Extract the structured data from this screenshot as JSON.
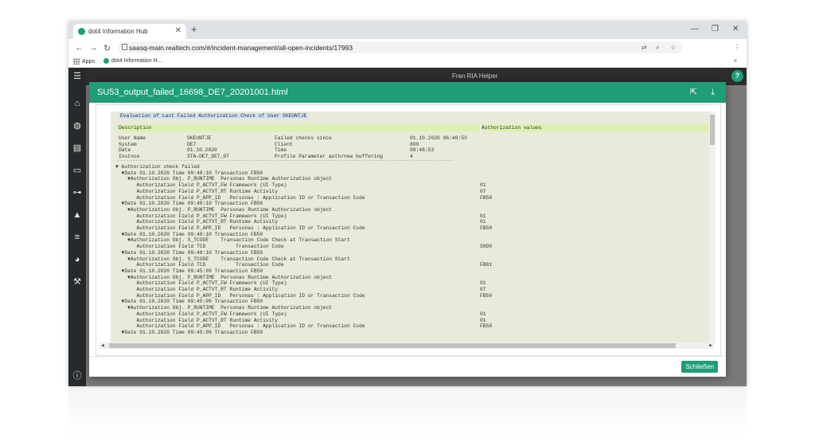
{
  "browser": {
    "tab_title": "dot4 Information Hub",
    "url": "saasq-main.realtech.com/#/incident-management/all-open-incidents/17993",
    "bookmark_apps": "Apps",
    "bookmark_hub": "dot4 Information H..."
  },
  "app": {
    "search_hint": "Fran RIA Helper"
  },
  "modal": {
    "title": "SU53_output_failed_16698_DE7_20201001.html",
    "close_label": "Schließen"
  },
  "report": {
    "heading": "Evaluation of Last Failed Authorization Check of User SKEUNTJE",
    "col_description": "Description",
    "col_auth_values": "Authorization values",
    "info_left": [
      {
        "label": "User Name",
        "value": "SKEUNTJE"
      },
      {
        "label": "System",
        "value": "DE7"
      },
      {
        "label": "Date",
        "value": "01.10.2020"
      },
      {
        "label": "Instnce",
        "value": "STA-DE7_DE7_07"
      }
    ],
    "info_right": [
      {
        "label": "Failed checks since",
        "value": "01.10.2020 06:48:53"
      },
      {
        "label": "Client",
        "value": "800"
      },
      {
        "label": "Time",
        "value": "09:48:53"
      },
      {
        "label": "Profile Parameter auth/new buffering",
        "value": "4"
      }
    ],
    "rule": "----------------------------------------------------------------------------------------------------------------",
    "lines": [
      {
        "text": "▼ Authorization check failed",
        "value": ""
      },
      {
        "text": "  ▼Date 01.10.2020 Time 09:48:10 Transaction FB50",
        "value": ""
      },
      {
        "text": "    ▼Authorization Obj. P_RUNTIME  Personas Runtime Authorization object",
        "value": ""
      },
      {
        "text": "       Authorization Field P_ACTVT_FW Framework (UI Type)",
        "value": "01"
      },
      {
        "text": "       Authorization Field P_ACTVT_RT Runtime Activity",
        "value": "07"
      },
      {
        "text": "       Authorization Field P_APP_ID   Personas : Application ID or Transaction Code",
        "value": "FB50"
      },
      {
        "text": "  ▼Date 01.10.2020 Time 09:48:10 Transaction FB50",
        "value": ""
      },
      {
        "text": "    ▼Authorization Obj. P_RUNTIME  Personas Runtime Authorization object",
        "value": ""
      },
      {
        "text": "       Authorization Field P_ACTVT_FW Framework (UI Type)",
        "value": "01"
      },
      {
        "text": "       Authorization Field P_ACTVT_RT Runtime Activity",
        "value": "01"
      },
      {
        "text": "       Authorization Field P_APP_ID   Personas : Application ID or Transaction Code",
        "value": "FB50"
      },
      {
        "text": "  ▼Date 01.10.2020 Time 09:48:10 Transaction FB50",
        "value": ""
      },
      {
        "text": "    ▼Authorization Obj. S_TCODE    Transaction Code Check at Transaction Start",
        "value": ""
      },
      {
        "text": "       Authorization Field TCD          Transaction Code",
        "value": "SHD0"
      },
      {
        "text": "  ▼Date 01.10.2020 Time 09:48:10 Transaction FB50",
        "value": ""
      },
      {
        "text": "    ▼Authorization Obj. S_TCODE    Transaction Code Check at Transaction Start",
        "value": ""
      },
      {
        "text": "       Authorization Field TCD          Transaction Code",
        "value": "FB01"
      },
      {
        "text": "  ▼Date 01.10.2020 Time 09:45:09 Transaction FB50",
        "value": ""
      },
      {
        "text": "    ▼Authorization Obj. P_RUNTIME  Personas Runtime Authorization object",
        "value": ""
      },
      {
        "text": "       Authorization Field P_ACTVT_FW Framework (UI Type)",
        "value": "01"
      },
      {
        "text": "       Authorization Field P_ACTVT_RT Runtime Activity",
        "value": "07"
      },
      {
        "text": "       Authorization Field P_APP_ID   Personas : Application ID or Transaction Code",
        "value": "FB50"
      },
      {
        "text": "  ▼Date 01.10.2020 Time 09:45:09 Transaction FB50",
        "value": ""
      },
      {
        "text": "    ▼Authorization Obj. P_RUNTIME  Personas Runtime Authorization object",
        "value": ""
      },
      {
        "text": "       Authorization Field P_ACTVT_FW Framework (UI Type)",
        "value": "01"
      },
      {
        "text": "       Authorization Field P_ACTVT_RT Runtime Activity",
        "value": "01"
      },
      {
        "text": "       Authorization Field P_APP_ID   Personas : Application ID or Transaction Code",
        "value": "FB50"
      },
      {
        "text": "  ▼Date 01.10.2020 Time 09:45:09 Transaction FB50",
        "value": ""
      }
    ]
  },
  "colors": {
    "accent": "#1f9c78",
    "report_bg": "#e9ead9",
    "desc_bar": "#dcf0b2"
  }
}
